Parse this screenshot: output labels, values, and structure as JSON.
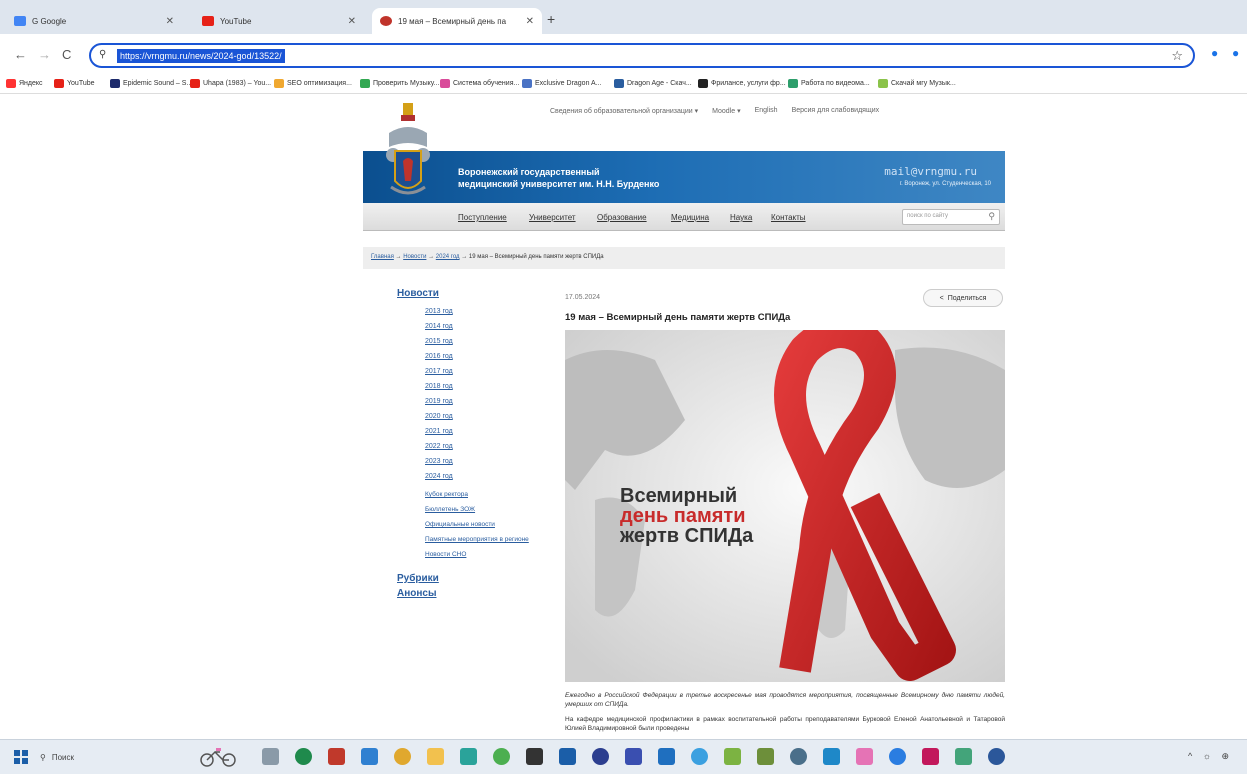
{
  "browser": {
    "tabs": [
      {
        "title": "G Google",
        "color": "#4285f4"
      },
      {
        "title": "YouTube",
        "color": "#e62117"
      },
      {
        "title": "19 мая – Всемирный день па",
        "color": "#c0342b"
      }
    ],
    "new_tab": "+",
    "url": "https://vrngmu.ru/news/2024-god/13522/",
    "nav": {
      "back": "←",
      "forward": "→",
      "reload": "C"
    },
    "star_icon": "☆",
    "bookmarks": [
      {
        "label": "Яндекс",
        "color": "#ff3333"
      },
      {
        "label": "YouTube",
        "color": "#e62117"
      },
      {
        "label": "Epidemic Sound – S...",
        "color": "#1c2a6b"
      },
      {
        "label": "Uhapa (1983) – You...",
        "color": "#e62117"
      },
      {
        "label": "SEO оптимизация...",
        "color": "#f0a830"
      },
      {
        "label": "Проверить Музыку...",
        "color": "#32a852"
      },
      {
        "label": "Система обучения...",
        "color": "#d94b9a"
      },
      {
        "label": "Exclusive Dragon A...",
        "color": "#4a72c4"
      },
      {
        "label": "Dragon Age - Скач...",
        "color": "#2a5d9f"
      },
      {
        "label": "Фрилансе, услуги фр...",
        "color": "#222222"
      },
      {
        "label": "Работа по видеома...",
        "color": "#2d9e6b"
      },
      {
        "label": "Скачай мгу Музык...",
        "color": "#8bc34a"
      }
    ]
  },
  "site": {
    "top_links": [
      "Сведения об образовательной организации ▾",
      "Moodle ▾",
      "English",
      "Версия для слабовидящих"
    ],
    "banner_title_1": "Воронежский государственный",
    "banner_title_2": "медицинский университет им. Н.Н. Бурденко",
    "banner_email": "mail@vrngmu.ru",
    "banner_address": "г. Воронеж, ул. Студенческая, 10",
    "nav": [
      "Поступление",
      "Университет",
      "Образование",
      "Медицина",
      "Наука",
      "Контакты"
    ],
    "search_placeholder": "поиск по сайту",
    "breadcrumb": {
      "home": "Главная",
      "news": "Новости",
      "year": "2024 год",
      "sep": "→",
      "current": "19 мая – Всемирный день памяти жертв СПИДа"
    }
  },
  "sidebar": {
    "heading_news": "Новости",
    "years": [
      "2013 год",
      "2014 год",
      "2015 год",
      "2016 год",
      "2017 год",
      "2018 год",
      "2019 год",
      "2020 год",
      "2021 год",
      "2022 год",
      "2023 год",
      "2024 год"
    ],
    "links": [
      "Кубок ректора",
      "Бюллетень ЗОЖ",
      "Официальные новости",
      "Памятные мероприятия в регионе",
      "Новости СНО"
    ],
    "heading_rubrics": "Рубрики",
    "heading_announcements": "Анонсы"
  },
  "article": {
    "date": "17.05.2024",
    "share_label": "Поделиться",
    "title": "19 мая – Всемирный день памяти жертв СПИДа",
    "poster_line1": "Всемирный",
    "poster_line2": "день памяти",
    "poster_line3": "жертв СПИДа",
    "lead": "Ежегодно в Российской Федерации в третье воскресенье мая проводятся мероприятия, посвященные Всемирному дню памяти людей, умерших от СПИДа.",
    "body": "На кафедре медицинской профилактики в рамках воспитательной работы преподавателями Бурковой Еленой Анатольевной и Татаровой Юлией Владимировной были проведены"
  },
  "taskbar": {
    "search_label": "Поиск",
    "icons": [
      {
        "name": "task-view-icon",
        "color": "#8a9aa8"
      },
      {
        "name": "chrome-icon",
        "color": "#1f8a4c"
      },
      {
        "name": "app-red-icon",
        "color": "#c0392b"
      },
      {
        "name": "app-blue-circle-icon",
        "color": "#2f80d1"
      },
      {
        "name": "app-yellow-icon",
        "color": "#e0a82e"
      },
      {
        "name": "files-icon",
        "color": "#f2c14e"
      },
      {
        "name": "app-teal-icon",
        "color": "#2aa39a"
      },
      {
        "name": "app-green-icon",
        "color": "#4caf50"
      },
      {
        "name": "app-dark-icon",
        "color": "#333333"
      },
      {
        "name": "app-blue-square-icon",
        "color": "#1b5ea8"
      },
      {
        "name": "app-navy-icon",
        "color": "#2c3e8f"
      },
      {
        "name": "app-indigo-icon",
        "color": "#3a4fb0"
      },
      {
        "name": "app-azure-icon",
        "color": "#1f6fbf"
      },
      {
        "name": "app-sky-icon",
        "color": "#3ba0e0"
      },
      {
        "name": "app-lime-icon",
        "color": "#7cb342"
      },
      {
        "name": "app-olive-icon",
        "color": "#6d8f3a"
      },
      {
        "name": "app-steel-icon",
        "color": "#4a6f8a"
      },
      {
        "name": "app-cyan-icon",
        "color": "#1e88c8"
      },
      {
        "name": "app-pink-icon",
        "color": "#e573b5"
      },
      {
        "name": "app-blue-icon",
        "color": "#2a7de1"
      },
      {
        "name": "app-magenta-icon",
        "color": "#c2185b"
      },
      {
        "name": "app-mint-icon",
        "color": "#43a47a"
      },
      {
        "name": "word-icon",
        "color": "#2b579a"
      }
    ],
    "tray": "^ ☼ ⊕"
  }
}
